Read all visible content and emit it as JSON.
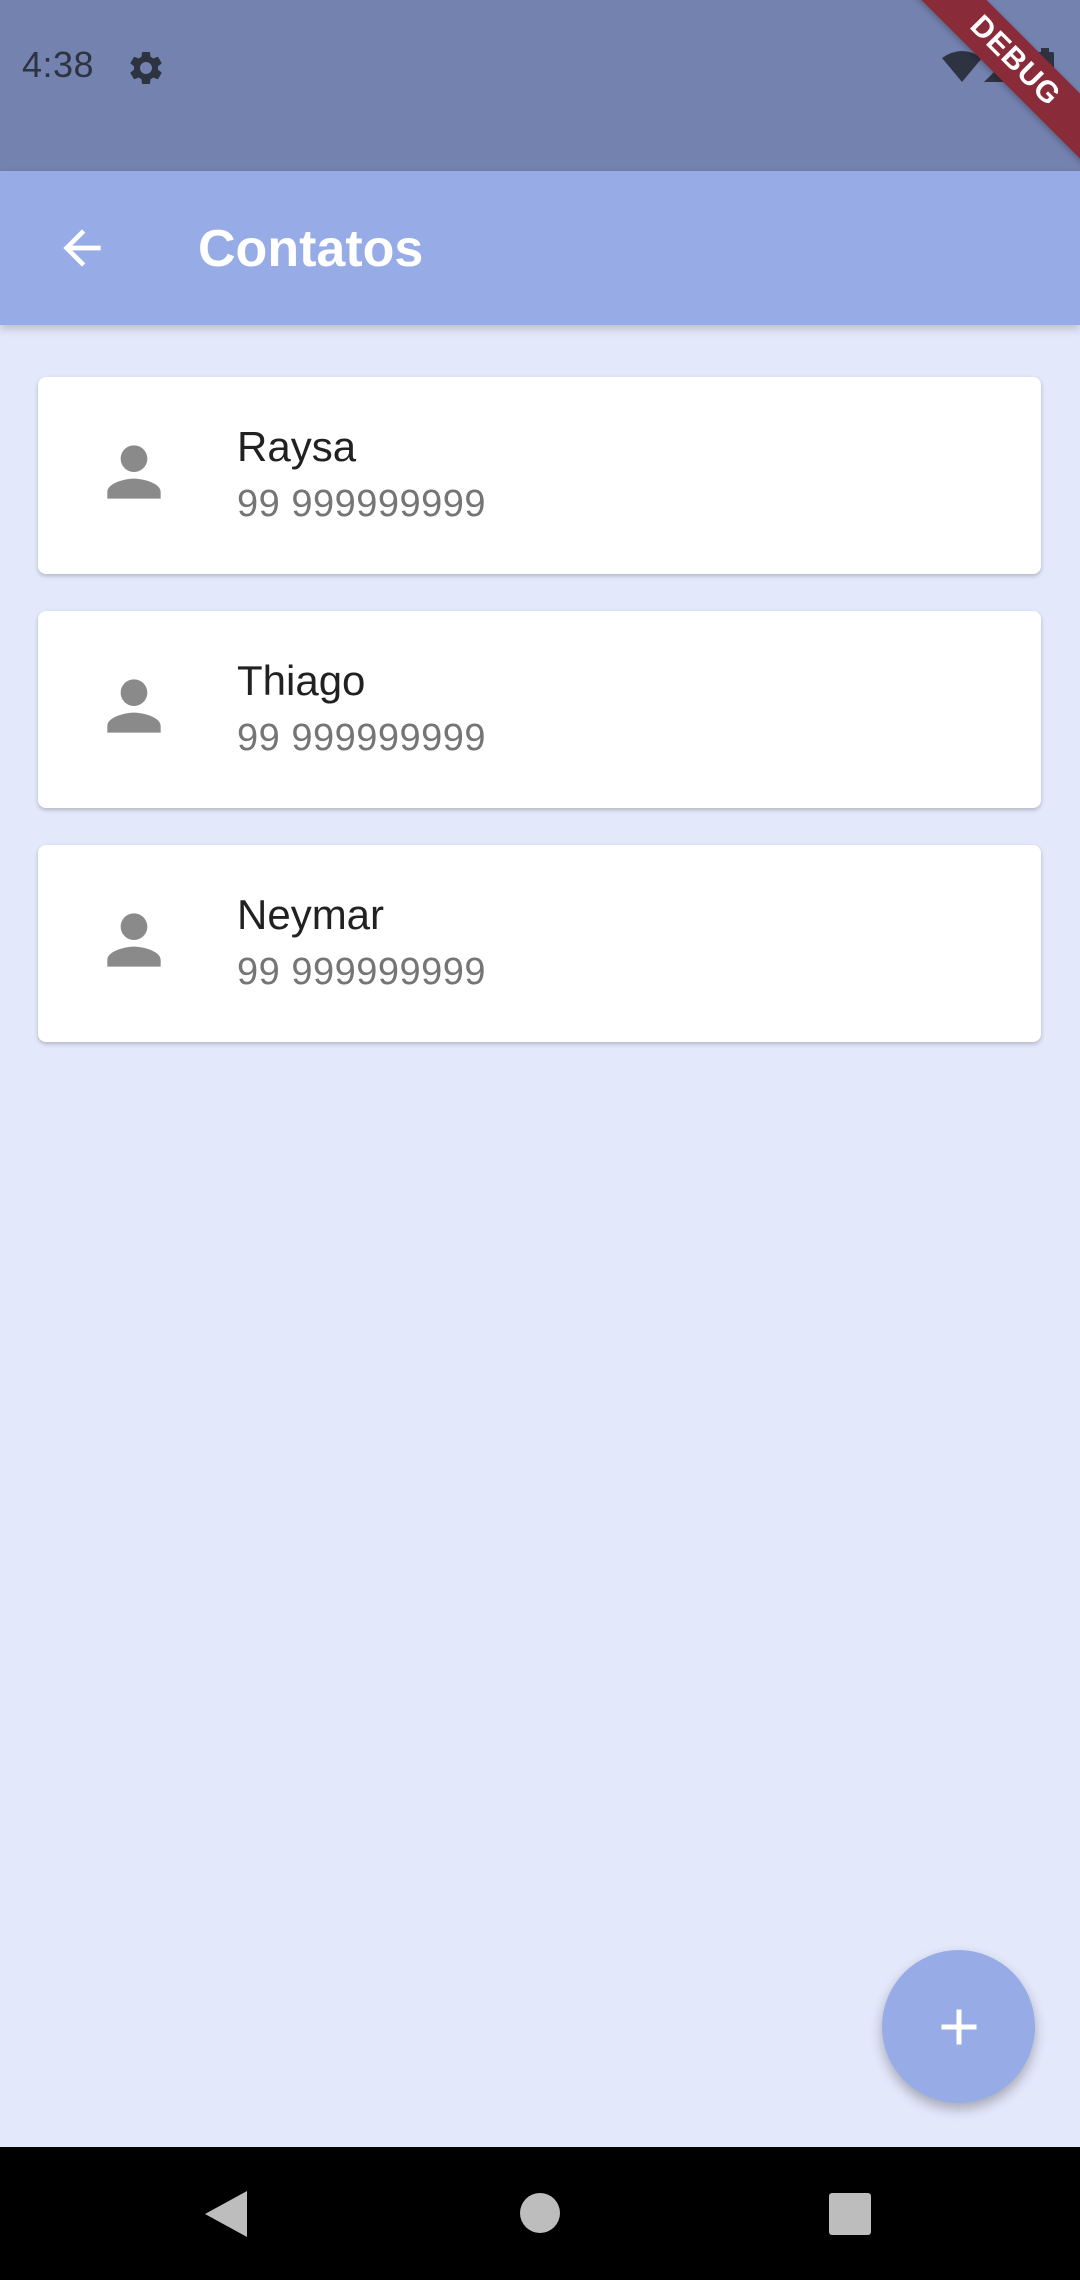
{
  "status_bar": {
    "time": "4:38",
    "icons": [
      "gear-icon",
      "wifi-icon",
      "signal-icon",
      "battery-icon"
    ],
    "debug_label": "DEBUG"
  },
  "app_bar": {
    "title": "Contatos",
    "back_icon": "arrow-left-icon"
  },
  "contacts": [
    {
      "name": "Raysa",
      "phone": "99 999999999",
      "icon": "person-icon"
    },
    {
      "name": "Thiago",
      "phone": "99 999999999",
      "icon": "person-icon"
    },
    {
      "name": "Neymar",
      "phone": "99 999999999",
      "icon": "person-icon"
    }
  ],
  "fab": {
    "icon": "plus-icon"
  },
  "nav_bar": {
    "icons": [
      "nav-back-icon",
      "nav-home-icon",
      "nav-recents-icon"
    ]
  },
  "colors": {
    "status_bar": "#7382ae",
    "app_bar": "#97ace6",
    "background": "#e3e8fb",
    "card": "#ffffff",
    "fab": "#97ace6",
    "debug_banner": "#8a2b39"
  }
}
